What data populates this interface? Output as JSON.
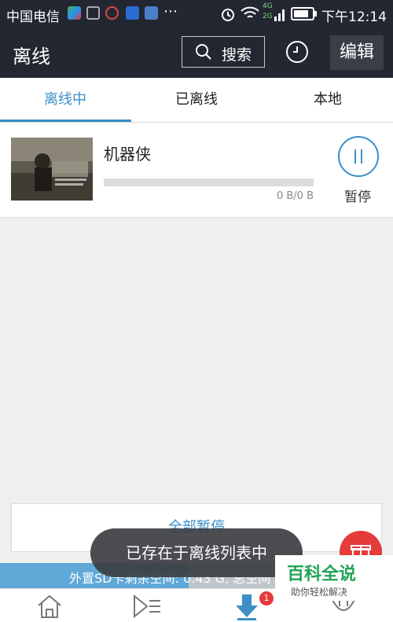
{
  "statusbar": {
    "carrier": "中国电信",
    "time": "下午12:14",
    "net_top": "4G",
    "net_bottom": "2G"
  },
  "header": {
    "title": "离线",
    "search_label": "搜索",
    "edit_label": "编辑"
  },
  "tabs": [
    {
      "label": "离线中"
    },
    {
      "label": "已离线"
    },
    {
      "label": "本地"
    }
  ],
  "download": {
    "title": "机器侠",
    "size": "0 B/0 B",
    "progress": 0,
    "pause_label": "暂停"
  },
  "actions": {
    "pause_all": "全部暂停"
  },
  "storage": {
    "text": "外置SD卡剩余空间: 0.43 G, 总空间"
  },
  "toast": {
    "text": "已存在于离线列表中"
  },
  "nav": {
    "badge": "1"
  },
  "watermark": {
    "title": "百科全说",
    "subtitle": "助你轻松解决"
  },
  "colors": {
    "accent": "#3c8fc8",
    "header": "#232731",
    "badge": "#e53b3b"
  }
}
